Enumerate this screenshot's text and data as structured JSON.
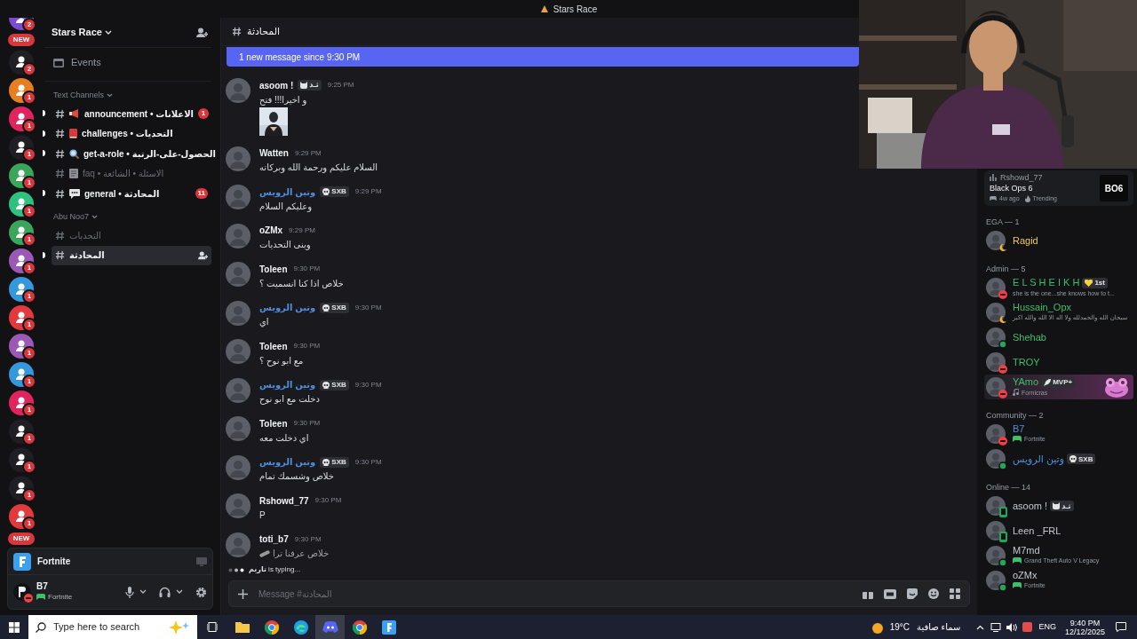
{
  "window": {
    "title": "Stars Race"
  },
  "server_rail": {
    "items": [
      {
        "kind": "server",
        "color": "#7b4bd0",
        "badge": "2"
      },
      {
        "kind": "new",
        "label": "NEW"
      },
      {
        "kind": "server",
        "color": "#1f1f23",
        "badge": "2"
      },
      {
        "kind": "server",
        "color": "#e67e22",
        "badge": "1"
      },
      {
        "kind": "server",
        "color": "#e0245e",
        "badge": "1"
      },
      {
        "kind": "server",
        "color": "#1f1f23",
        "badge": "1"
      },
      {
        "kind": "server",
        "color": "#3ba55c",
        "badge": "1"
      },
      {
        "kind": "server",
        "color": "#2ec27e",
        "badge": "1"
      },
      {
        "kind": "server",
        "color": "#3ba55c",
        "badge": "1"
      },
      {
        "kind": "server",
        "color": "#9b59b6",
        "badge": "1"
      },
      {
        "kind": "server",
        "color": "#3498db",
        "badge": "1"
      },
      {
        "kind": "server",
        "color": "#e03a3e",
        "badge": "1"
      },
      {
        "kind": "server",
        "color": "#9b59b6",
        "badge": "1"
      },
      {
        "kind": "server",
        "color": "#3498db",
        "badge": "1"
      },
      {
        "kind": "server",
        "color": "#e0245e",
        "badge": "1"
      },
      {
        "kind": "server",
        "color": "#1f1f23",
        "badge": "1"
      },
      {
        "kind": "server",
        "color": "#1f1f23",
        "badge": "1"
      },
      {
        "kind": "server",
        "color": "#1f1f23",
        "badge": "1"
      },
      {
        "kind": "server",
        "color": "#e03a3e",
        "badge": "1"
      },
      {
        "kind": "new",
        "label": "NEW"
      }
    ]
  },
  "channel_sidebar": {
    "server_name": "Stars Race",
    "events": "Events",
    "categories": [
      {
        "name": "Text Channels",
        "channels": [
          {
            "kind": "megaphone",
            "name": "announcement • الاعلانات",
            "unread": true,
            "selected": false,
            "badge": "1"
          },
          {
            "kind": "book",
            "name": "challenges • التحديات",
            "unread": true,
            "selected": false
          },
          {
            "kind": "magnifier",
            "name": "get-a-role • الحصول-على-الرتبة",
            "unread": true,
            "selected": false
          },
          {
            "kind": "memo",
            "name": "faq • الاسئلة • الشائعة",
            "unread": false,
            "selected": false
          },
          {
            "kind": "speech",
            "name": "general • المحادثة",
            "unread": true,
            "selected": false,
            "badge": "11"
          }
        ]
      },
      {
        "name": "Abu Noo7",
        "channels": [
          {
            "kind": "plain",
            "name": "التحديات",
            "unread": false,
            "selected": false
          },
          {
            "kind": "plain",
            "name": "المحادثة",
            "unread": true,
            "selected": true
          }
        ]
      }
    ]
  },
  "activity_card": {
    "game": "Fortnite"
  },
  "user_panel": {
    "name": "B7",
    "activity": "Fortnite",
    "kind": "dnd"
  },
  "chat": {
    "channel": "المحادثة",
    "new_banner": "1 new message since 9:30 PM",
    "messages": [
      {
        "author": "asoom !",
        "color": "#f2f3f5",
        "tag": {
          "kind": "cat",
          "text": "ثـد"
        },
        "time": "9:25 PM",
        "text": "و اخيرا!!! فتح"
      },
      {
        "author": "Watten",
        "color": "#f2f3f5",
        "time": "9:29 PM",
        "text": "السلام عليكم ورحمة الله وبركاته"
      },
      {
        "author": "وتين الرويس",
        "color": "#4f8fdc",
        "tag": {
          "kind": "skull",
          "text": "SXB"
        },
        "time": "9:29 PM",
        "text": "وعليكم السلام"
      },
      {
        "author": "oZMx",
        "color": "#f2f3f5",
        "time": "9:29 PM",
        "text": "وينى التحديات"
      },
      {
        "author": "Toleen",
        "color": "#f2f3f5",
        "time": "9:30 PM",
        "text": "خلاص اذا كنا انسميت ؟"
      },
      {
        "author": "وتين الرويس",
        "color": "#4f8fdc",
        "tag": {
          "kind": "skull",
          "text": "SXB"
        },
        "time": "9:30 PM",
        "text": "اي"
      },
      {
        "author": "Toleen",
        "color": "#f2f3f5",
        "time": "9:30 PM",
        "text": "مع ابو نوح ؟"
      },
      {
        "author": "وتين الرويس",
        "color": "#4f8fdc",
        "tag": {
          "kind": "skull",
          "text": "SXB"
        },
        "time": "9:30 PM",
        "text": "دخلت مع ابو نوح"
      },
      {
        "author": "Toleen",
        "color": "#f2f3f5",
        "time": "9:30 PM",
        "text": "اي دخلت معه"
      },
      {
        "author": "وتين الرويس",
        "color": "#4f8fdc",
        "tag": {
          "kind": "skull",
          "text": "SXB"
        },
        "time": "9:30 PM",
        "text": "خلاص وشسمك تمام"
      },
      {
        "author": "Rshowd_77",
        "color": "#f2f3f5",
        "time": "9:30 PM",
        "text": "P"
      },
      {
        "author": "toti_b7",
        "color": "#f2f3f5",
        "sticker": true,
        "time": "9:30 PM",
        "text": "خلاص عرفنا ترا"
      }
    ],
    "typing": "**تاريم** is typing...",
    "composer": {
      "placeholder": "Message #المحادثة"
    }
  },
  "members": {
    "card": {
      "user": "Rshowd_77",
      "game": "Black Ops 6",
      "ago": "4w ago",
      "trend": "Trending",
      "logo": "BO6"
    },
    "groups": [
      {
        "title": "EGA — 1",
        "members": [
          {
            "name": "Ragid",
            "color": "#f0c85a",
            "kind": "idle",
            "highlight": false
          }
        ]
      },
      {
        "title": "Admin — 5",
        "members": [
          {
            "name": "E L S H E I K H",
            "color": "#3fbf6a",
            "kind": "dnd",
            "highlight": false,
            "tag": {
              "kind": "heart",
              "text": "1st"
            },
            "activity": {
              "kind": "custom",
              "text": "she is the one...she knows how to t..."
            }
          },
          {
            "name": "Hussain_Opx",
            "color": "#3fbf6a",
            "kind": "idle",
            "highlight": false,
            "activity": {
              "kind": "custom",
              "text": "سبحان الله والحمدلله ولا اله الا الله والله اكبر"
            }
          },
          {
            "name": "Shehab",
            "color": "#3fbf6a",
            "kind": "online",
            "highlight": false
          },
          {
            "name": "TROY",
            "color": "#3fbf6a",
            "kind": "dnd",
            "highlight": false
          },
          {
            "name": "YAmo",
            "color": "#3fbf6a",
            "kind": "dnd",
            "highlight": true,
            "tag": {
              "kind": "rocket",
              "text": "MVP+"
            },
            "activity": {
              "kind": "music",
              "text": "Fornicras"
            }
          }
        ]
      },
      {
        "title": "Community — 2",
        "members": [
          {
            "name": "B7",
            "color": "#4f8fdc",
            "kind": "dnd",
            "highlight": false,
            "activity": {
              "kind": "game",
              "text": "Fortnite"
            }
          },
          {
            "name": "وتين الرويس",
            "color": "#4f8fdc",
            "kind": "online",
            "highlight": false,
            "tag": {
              "kind": "skull",
              "text": "SXB"
            }
          }
        ]
      },
      {
        "title": "Online — 14",
        "members": [
          {
            "name": "asoom !",
            "color": "#c4c9ce",
            "kind": "mobile",
            "highlight": false,
            "tag": {
              "kind": "cat",
              "text": "ثـد"
            }
          },
          {
            "name": "Leen _FRL",
            "color": "#c4c9ce",
            "kind": "mobile",
            "highlight": false
          },
          {
            "name": "M7md",
            "color": "#c4c9ce",
            "kind": "online",
            "highlight": false,
            "activity": {
              "kind": "game",
              "text": "Grand Theft Auto V Legacy"
            }
          },
          {
            "name": "oZMx",
            "color": "#c4c9ce",
            "kind": "online",
            "highlight": false,
            "activity": {
              "kind": "game",
              "text": "Fortnite"
            }
          }
        ]
      }
    ]
  },
  "taskbar": {
    "search_placeholder": "Type here to search",
    "temperature": "19°C",
    "weather": "سماء صافية",
    "language": "ENG",
    "time": "9:40 PM",
    "date": "12/12/2025"
  }
}
